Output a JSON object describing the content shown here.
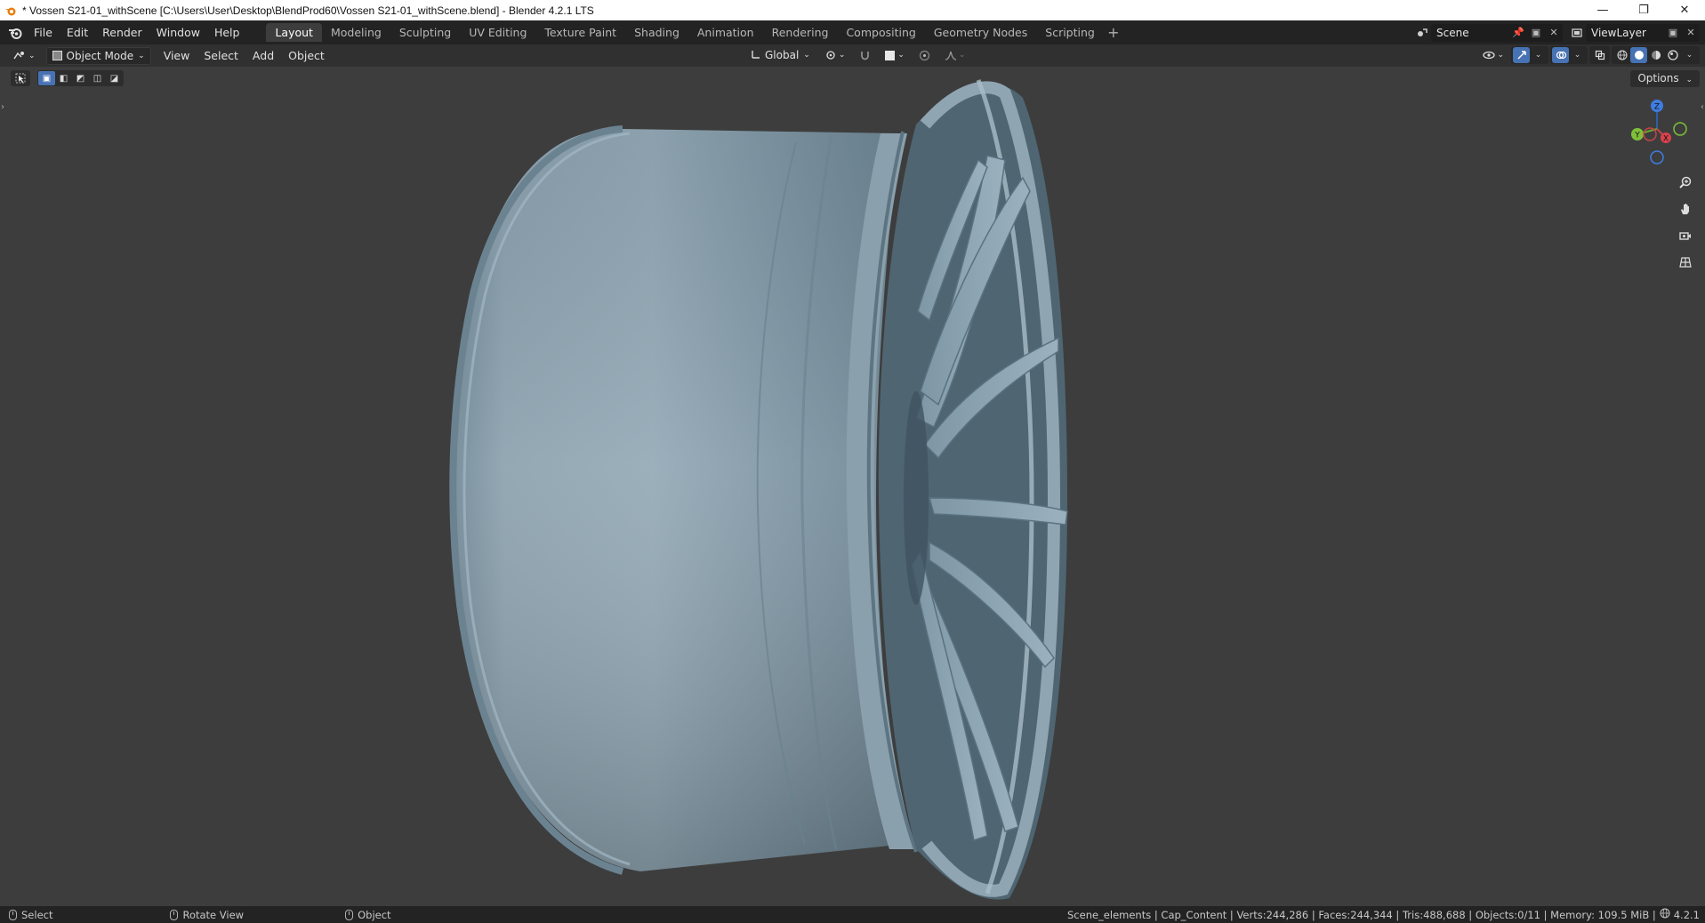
{
  "window": {
    "title": "* Vossen S21-01_withScene [C:\\Users\\User\\Desktop\\BlendProd60\\Vossen S21-01_withScene.blend] - Blender 4.2.1 LTS",
    "minimize": "—",
    "restore": "❐",
    "close": "✕"
  },
  "menu": [
    "File",
    "Edit",
    "Render",
    "Window",
    "Help"
  ],
  "workspaces": [
    "Layout",
    "Modeling",
    "Sculpting",
    "UV Editing",
    "Texture Paint",
    "Shading",
    "Animation",
    "Rendering",
    "Compositing",
    "Geometry Nodes",
    "Scripting"
  ],
  "workspace_add": "+",
  "scene_name": "Scene",
  "view_layer": "ViewLayer",
  "header": {
    "mode": "Object Mode",
    "view": "View",
    "select": "Select",
    "add": "Add",
    "object": "Object",
    "orientation": "Global"
  },
  "viewport": {
    "options": "Options",
    "gizmo": {
      "z": "Z",
      "y": "Y",
      "x": "X"
    },
    "object_color": "#8fa5b3"
  },
  "status": {
    "left": [
      {
        "label": "Select"
      },
      {
        "label": "Rotate View"
      },
      {
        "label": "Object"
      }
    ],
    "stats": "Scene_elements | Cap_Content | Verts:244,286 | Faces:244,344 | Tris:488,688 | Objects:0/11 | Memory: 109.5 MiB |",
    "version": "4.2.1"
  }
}
